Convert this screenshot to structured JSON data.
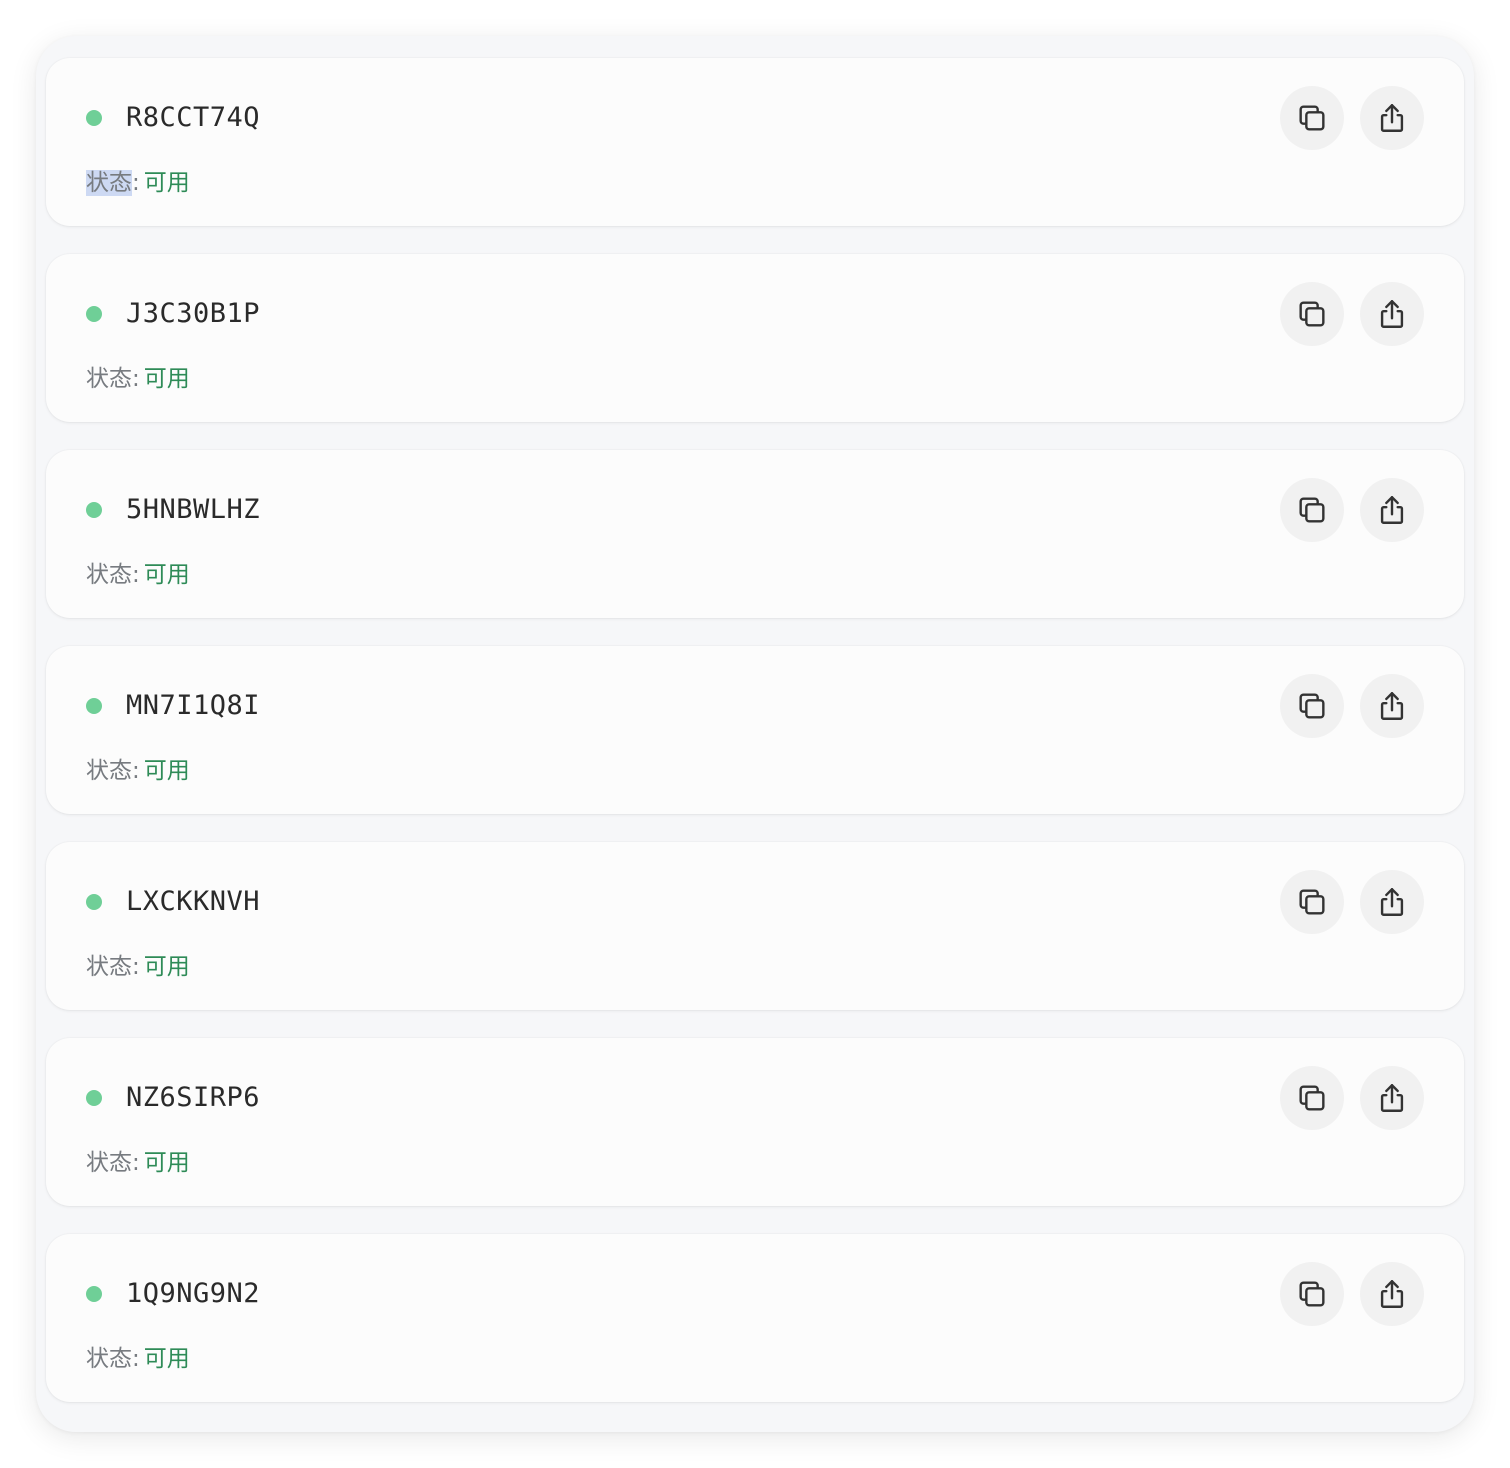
{
  "items": [
    {
      "code": "R8CCT74Q",
      "status_label": "状态",
      "status_value": "可用"
    },
    {
      "code": "J3C30B1P",
      "status_label": "状态",
      "status_value": "可用"
    },
    {
      "code": "5HNBWLHZ",
      "status_label": "状态",
      "status_value": "可用"
    },
    {
      "code": "MN7I1Q8I",
      "status_label": "状态",
      "status_value": "可用"
    },
    {
      "code": "LXCKKNVH",
      "status_label": "状态",
      "status_value": "可用"
    },
    {
      "code": "NZ6SIRP6",
      "status_label": "状态",
      "status_value": "可用"
    },
    {
      "code": "1Q9NG9N2",
      "status_label": "状态",
      "status_value": "可用"
    }
  ],
  "colors": {
    "dot": "#6fcf97",
    "status_value": "#2e8b57",
    "status_label": "#777b80"
  },
  "icons": {
    "copy": "copy-icon",
    "share": "share-icon"
  }
}
